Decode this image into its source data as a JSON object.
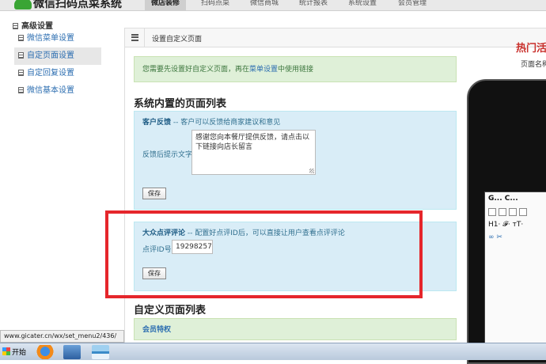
{
  "app": {
    "title": "微信扫码点菜系统"
  },
  "nav": {
    "tabs": [
      "微店装修",
      "扫码点菜",
      "微信商城",
      "统计报表",
      "系统设置",
      "会员管理"
    ],
    "active_index": 0
  },
  "sidebar": {
    "heading": "高级设置",
    "items": [
      {
        "label": "微信菜单设置"
      },
      {
        "label": "自定页面设置"
      },
      {
        "label": "自定回复设置"
      },
      {
        "label": "微信基本设置"
      }
    ],
    "active_index": 1
  },
  "breadcrumb": {
    "text": "设置自定义页面"
  },
  "notice": {
    "before": "您需要先设置好自定义页面，再在",
    "link": "菜单设置",
    "after": "中使用链接"
  },
  "builtin_section": {
    "title": "系统内置的页面列表"
  },
  "feedback_panel": {
    "title": "客户反馈",
    "desc": " -- 客户可以反馈给商家建议和意见",
    "label": "反馈后提示文字",
    "value": "感谢您向本餐厅提供反馈，请点击以下链接向店长留言",
    "button": "保存"
  },
  "review_panel": {
    "title": "大众点评评论",
    "desc": " -- 配置好点评ID后，可以直接让用户查看点评评论",
    "label": "点评ID号",
    "value": "19298257",
    "button": "保存"
  },
  "custom_section": {
    "title": "自定义页面列表"
  },
  "member_panel": {
    "title": "会员特权"
  },
  "preview": {
    "title": "热门活",
    "subtitle": "页面名称",
    "toolbar_text": "G... C...",
    "row2": "H1·  𝓕·  ᴛT·",
    "row3": "∞  ✂"
  },
  "statusbar": {
    "url": "www.gicater.cn/wx/set_menu2/436/"
  },
  "taskbar": {
    "start_label": "开始"
  },
  "colors": {
    "highlight": "#e5262b",
    "panel_blue": "#d9edf7",
    "panel_green": "#dff0d8",
    "link": "#2b6db0"
  }
}
